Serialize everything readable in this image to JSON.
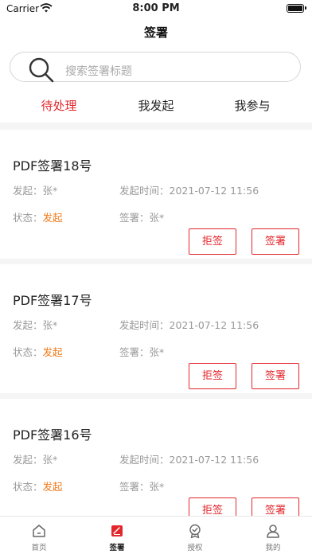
{
  "status_bar": {
    "carrier": "Carrier",
    "time": "8:00 PM"
  },
  "nav": {
    "title": "签署"
  },
  "search": {
    "placeholder": "搜索签署标题"
  },
  "tabs": [
    {
      "label": "待处理",
      "active": true
    },
    {
      "label": "我发起",
      "active": false
    },
    {
      "label": "我参与",
      "active": false
    }
  ],
  "meta_labels": {
    "initiator": "发起：",
    "time": "发起时间：",
    "status": "状态：",
    "signer": "签署："
  },
  "documents": [
    {
      "title": "PDF签署18号",
      "initiator": "张*",
      "time": "2021-07-12 11:56",
      "status": "发起",
      "signer": "张*",
      "reject_label": "拒签",
      "sign_label": "签署"
    },
    {
      "title": "PDF签署17号",
      "initiator": "张*",
      "time": "2021-07-12 11:56",
      "status": "发起",
      "signer": "张*",
      "reject_label": "拒签",
      "sign_label": "签署"
    },
    {
      "title": "PDF签署16号",
      "initiator": "张*",
      "time": "2021-07-12 11:56",
      "status": "发起",
      "signer": "张*",
      "reject_label": "拒签",
      "sign_label": "签署"
    }
  ],
  "tabbar": [
    {
      "label": "首页",
      "icon": "home-icon",
      "active": false
    },
    {
      "label": "签署",
      "icon": "sign-icon",
      "active": true
    },
    {
      "label": "授权",
      "icon": "authorize-icon",
      "active": false
    },
    {
      "label": "我的",
      "icon": "profile-icon",
      "active": false
    }
  ],
  "colors": {
    "accent": "#e3262b",
    "status_orange": "#f07a1a",
    "muted": "#999999"
  }
}
